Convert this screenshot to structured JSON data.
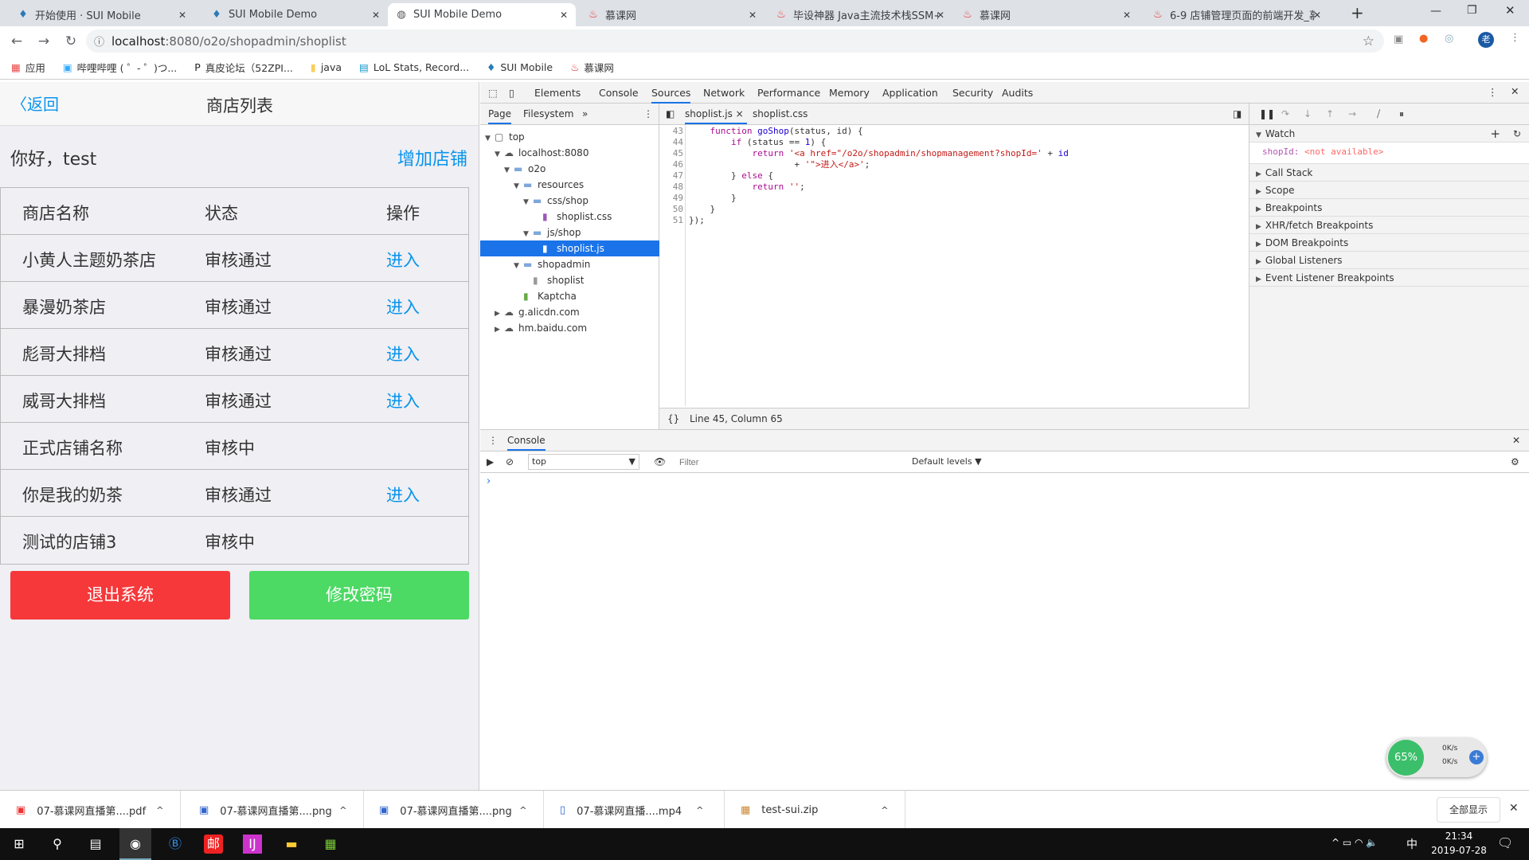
{
  "browser": {
    "tabs": [
      {
        "label": "开始使用 · SUI Mobile",
        "icon": "sui-icon"
      },
      {
        "label": "SUI Mobile Demo",
        "icon": "sui-icon"
      },
      {
        "label": "SUI Mobile Demo",
        "icon": "globe-icon",
        "active": true
      },
      {
        "label": "慕课网",
        "icon": "flame-icon"
      },
      {
        "label": "毕设神器 Java主流技术栈SSM+S",
        "icon": "flame-icon"
      },
      {
        "label": "慕课网",
        "icon": "flame-icon"
      },
      {
        "label": "6-9 店铺管理页面的前端开发_慕",
        "icon": "flame-icon"
      }
    ],
    "url_host": "localhost",
    "url_rest": ":8080/o2o/shopadmin/shoplist",
    "bookmarks": [
      "应用",
      "哔哩哔哩 ( ゜- ゜)つ...",
      "真皮论坛（52ZPI...",
      "java",
      "LoL Stats, Record...",
      "SUI Mobile",
      "慕课网"
    ],
    "profile_initial": "老"
  },
  "page": {
    "back": "返回",
    "title": "商店列表",
    "greeting": "你好，test",
    "add_shop": "增加店铺",
    "headers": [
      "商店名称",
      "状态",
      "操作"
    ],
    "rows": [
      [
        "小黄人主题奶茶店",
        "审核通过",
        "进入"
      ],
      [
        "暴漫奶茶店",
        "审核通过",
        "进入"
      ],
      [
        "彪哥大排档",
        "审核通过",
        "进入"
      ],
      [
        "威哥大排档",
        "审核通过",
        "进入"
      ],
      [
        "正式店铺名称",
        "审核中",
        ""
      ],
      [
        "你是我的奶茶",
        "审核通过",
        "进入"
      ],
      [
        "测试的店铺3",
        "审核中",
        ""
      ]
    ],
    "logout": "退出系统",
    "change_pwd": "修改密码",
    "colors": {
      "link": "#0894ec",
      "logout": "#f6383a",
      "change": "#4cd964"
    }
  },
  "devtools": {
    "tabs": [
      "Elements",
      "Console",
      "Sources",
      "Network",
      "Performance",
      "Memory",
      "Application",
      "Security",
      "Audits"
    ],
    "active_tab": "Sources",
    "nav_tabs": [
      "Page",
      "Filesystem"
    ],
    "tree": [
      {
        "label": "top",
        "depth": 0,
        "arrow": "▼",
        "icon": "frame-icon"
      },
      {
        "label": "localhost:8080",
        "depth": 1,
        "arrow": "▼",
        "icon": "cloud-icon"
      },
      {
        "label": "o2o",
        "depth": 2,
        "arrow": "▼",
        "icon": "folder-icon"
      },
      {
        "label": "resources",
        "depth": 3,
        "arrow": "▼",
        "icon": "folder-icon"
      },
      {
        "label": "css/shop",
        "depth": 4,
        "arrow": "▼",
        "icon": "folder-icon"
      },
      {
        "label": "shoplist.css",
        "depth": 5,
        "arrow": "",
        "icon": "css-file-icon"
      },
      {
        "label": "js/shop",
        "depth": 4,
        "arrow": "▼",
        "icon": "folder-icon"
      },
      {
        "label": "shoplist.js",
        "depth": 5,
        "arrow": "",
        "icon": "js-file-icon",
        "selected": true
      },
      {
        "label": "shopadmin",
        "depth": 3,
        "arrow": "▼",
        "icon": "folder-icon"
      },
      {
        "label": "shoplist",
        "depth": 4,
        "arrow": "",
        "icon": "file-icon"
      },
      {
        "label": "Kaptcha",
        "depth": 3,
        "arrow": "",
        "icon": "image-file-icon"
      },
      {
        "label": "g.alicdn.com",
        "depth": 1,
        "arrow": "▶",
        "icon": "cloud-icon"
      },
      {
        "label": "hm.baidu.com",
        "depth": 1,
        "arrow": "▶",
        "icon": "cloud-icon"
      }
    ],
    "editor_tabs": [
      "shoplist.js",
      "shoplist.css"
    ],
    "lines": [
      43,
      44,
      45,
      46,
      47,
      48,
      49,
      50,
      51
    ],
    "code": [
      "    <k>function</k> <f>goShop</f>(status, id) {",
      "        <k>if</k> (status == <n>1</n>) {",
      "            <k>return</k> <s>'&lt;a href=\"/o2o/shopadmin/shopmanagement?shopId='</s> + <n>id</n>",
      "                    + <s>'\"&gt;进入&lt;/a&gt;'</s>;",
      "        } <k>else</k> {",
      "            <k>return</k> <s>''</s>;",
      "        }",
      "    }",
      "});"
    ],
    "status": "Line 45, Column 65",
    "watch_title": "Watch",
    "watch_key": "shopId:",
    "watch_val": "<not available>",
    "panes": [
      "Call Stack",
      "Scope",
      "Breakpoints",
      "XHR/fetch Breakpoints",
      "DOM Breakpoints",
      "Global Listeners",
      "Event Listener Breakpoints"
    ],
    "console_tab": "Console",
    "context": "top",
    "filter_placeholder": "Filter",
    "levels": "Default levels ▼",
    "prompt": "›"
  },
  "widget": {
    "percent": "65%",
    "up": "0K/s",
    "down": "0K/s"
  },
  "downloads": {
    "items": [
      "07-慕课网直播第....pdf",
      "07-慕课网直播第....png",
      "07-慕课网直播第....png",
      "07-慕课网直播....mp4",
      "test-sui.zip"
    ],
    "show_all": "全部显示"
  },
  "taskbar": {
    "time": "21:34",
    "date": "2019-07-28",
    "ime": "中"
  }
}
